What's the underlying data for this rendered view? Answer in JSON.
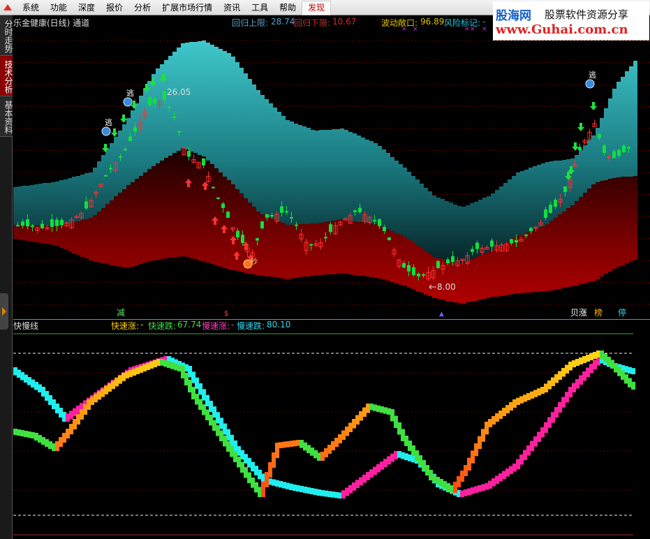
{
  "menu": {
    "items": [
      "系统",
      "功能",
      "深度",
      "报价",
      "分析",
      "扩展市场行情",
      "资讯",
      "工具",
      "帮助"
    ],
    "discover": "发现"
  },
  "banner": {
    "brand": "股海网",
    "slogan": "股票软件资源分享",
    "url": "www.Guhai.com.cn"
  },
  "side_tabs": [
    "分时走势",
    "技术分析",
    "基本资料"
  ],
  "main_header": {
    "title": "乐金健康(日线) 通道",
    "upper_label": "回归上限:",
    "upper_value": "28.74",
    "lower_label": "回归下限:",
    "lower_value": "10.67",
    "wave_label": "波动敞口:",
    "wave_value": "96.89",
    "risk_label": "风险标记:",
    "risk_value": "-"
  },
  "annotations": {
    "high_price": "26.05",
    "low_price": "8.00",
    "escape": "逃",
    "hand": "抄",
    "reduce": "减",
    "bottom_labels": [
      "贝涨",
      "榜",
      "停"
    ]
  },
  "osc_header": {
    "title": "快慢线",
    "fast_up_label": "快速涨:",
    "fast_up_value": "-",
    "fast_down_label": "快速跌:",
    "fast_down_value": "67.74",
    "slow_up_label": "慢速涨:",
    "slow_up_value": "-",
    "slow_down_label": "慢速跌:",
    "slow_down_value": "80.10"
  },
  "colors": {
    "up": "#ff3030",
    "down": "#00e040",
    "channel_top": "#2aa9b0",
    "channel_bottom": "#8a0000",
    "fast_line": "#22eeee",
    "slow_line": "#ff22aa",
    "grid": "#800000"
  },
  "chart_data": {
    "type": "line",
    "series": [],
    "ylim": [
      0,
      100
    ]
  }
}
